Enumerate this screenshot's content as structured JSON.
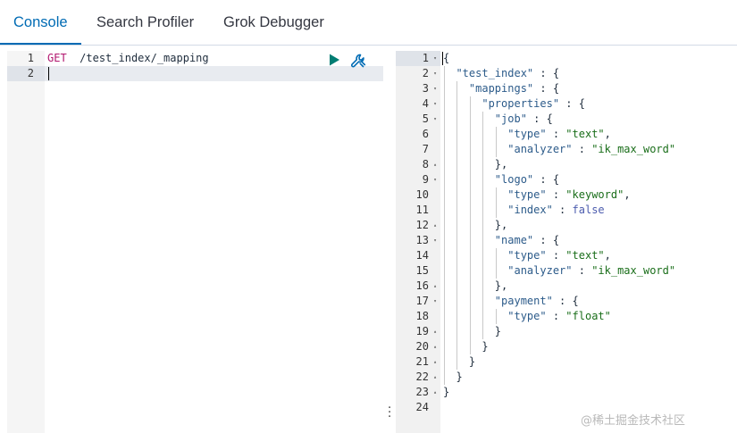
{
  "tabs": [
    {
      "label": "Console"
    },
    {
      "label": "Search Profiler"
    },
    {
      "label": "Grok Debugger"
    }
  ],
  "request": {
    "line_numbers": [
      "1",
      "2"
    ],
    "method": "GET",
    "path": "/test_index/_mapping"
  },
  "response": {
    "line_numbers": [
      "1",
      "2",
      "3",
      "4",
      "5",
      "6",
      "7",
      "8",
      "9",
      "10",
      "11",
      "12",
      "13",
      "14",
      "15",
      "16",
      "17",
      "18",
      "19",
      "20",
      "21",
      "22",
      "23",
      "24"
    ],
    "lines": [
      [
        {
          "t": "{",
          "c": "punc"
        }
      ],
      [
        {
          "t": "  ",
          "c": "punc"
        },
        {
          "t": "\"test_index\"",
          "c": "str-key"
        },
        {
          "t": " : {",
          "c": "punc"
        }
      ],
      [
        {
          "t": "    ",
          "c": "punc"
        },
        {
          "t": "\"mappings\"",
          "c": "str-key"
        },
        {
          "t": " : {",
          "c": "punc"
        }
      ],
      [
        {
          "t": "      ",
          "c": "punc"
        },
        {
          "t": "\"properties\"",
          "c": "str-key"
        },
        {
          "t": " : {",
          "c": "punc"
        }
      ],
      [
        {
          "t": "        ",
          "c": "punc"
        },
        {
          "t": "\"job\"",
          "c": "str-key"
        },
        {
          "t": " : {",
          "c": "punc"
        }
      ],
      [
        {
          "t": "          ",
          "c": "punc"
        },
        {
          "t": "\"type\"",
          "c": "str-key"
        },
        {
          "t": " : ",
          "c": "punc"
        },
        {
          "t": "\"text\"",
          "c": "str-val"
        },
        {
          "t": ",",
          "c": "punc"
        }
      ],
      [
        {
          "t": "          ",
          "c": "punc"
        },
        {
          "t": "\"analyzer\"",
          "c": "str-key"
        },
        {
          "t": " : ",
          "c": "punc"
        },
        {
          "t": "\"ik_max_word\"",
          "c": "str-val"
        }
      ],
      [
        {
          "t": "        },",
          "c": "punc"
        }
      ],
      [
        {
          "t": "        ",
          "c": "punc"
        },
        {
          "t": "\"logo\"",
          "c": "str-key"
        },
        {
          "t": " : {",
          "c": "punc"
        }
      ],
      [
        {
          "t": "          ",
          "c": "punc"
        },
        {
          "t": "\"type\"",
          "c": "str-key"
        },
        {
          "t": " : ",
          "c": "punc"
        },
        {
          "t": "\"keyword\"",
          "c": "str-val"
        },
        {
          "t": ",",
          "c": "punc"
        }
      ],
      [
        {
          "t": "          ",
          "c": "punc"
        },
        {
          "t": "\"index\"",
          "c": "str-key"
        },
        {
          "t": " : ",
          "c": "punc"
        },
        {
          "t": "false",
          "c": "bool"
        }
      ],
      [
        {
          "t": "        },",
          "c": "punc"
        }
      ],
      [
        {
          "t": "        ",
          "c": "punc"
        },
        {
          "t": "\"name\"",
          "c": "str-key"
        },
        {
          "t": " : {",
          "c": "punc"
        }
      ],
      [
        {
          "t": "          ",
          "c": "punc"
        },
        {
          "t": "\"type\"",
          "c": "str-key"
        },
        {
          "t": " : ",
          "c": "punc"
        },
        {
          "t": "\"text\"",
          "c": "str-val"
        },
        {
          "t": ",",
          "c": "punc"
        }
      ],
      [
        {
          "t": "          ",
          "c": "punc"
        },
        {
          "t": "\"analyzer\"",
          "c": "str-key"
        },
        {
          "t": " : ",
          "c": "punc"
        },
        {
          "t": "\"ik_max_word\"",
          "c": "str-val"
        }
      ],
      [
        {
          "t": "        },",
          "c": "punc"
        }
      ],
      [
        {
          "t": "        ",
          "c": "punc"
        },
        {
          "t": "\"payment\"",
          "c": "str-key"
        },
        {
          "t": " : {",
          "c": "punc"
        }
      ],
      [
        {
          "t": "          ",
          "c": "punc"
        },
        {
          "t": "\"type\"",
          "c": "str-key"
        },
        {
          "t": " : ",
          "c": "punc"
        },
        {
          "t": "\"float\"",
          "c": "str-val"
        }
      ],
      [
        {
          "t": "        }",
          "c": "punc"
        }
      ],
      [
        {
          "t": "      }",
          "c": "punc"
        }
      ],
      [
        {
          "t": "    }",
          "c": "punc"
        }
      ],
      [
        {
          "t": "  }",
          "c": "punc"
        }
      ],
      [
        {
          "t": "}",
          "c": "punc"
        }
      ],
      []
    ],
    "fold_markers": [
      "▾",
      "▾",
      "▾",
      "▾",
      "▾",
      "",
      "",
      "▴",
      "▾",
      "",
      "",
      "▴",
      "▾",
      "",
      "",
      "▴",
      "▾",
      "",
      "▴",
      "▴",
      "▴",
      "▴",
      "▴",
      ""
    ]
  },
  "icons": {
    "run": "play-icon",
    "settings": "wrench-icon",
    "resizer": "vertical-dots-icon"
  },
  "watermark": "@稀土掘金技术社区",
  "colors": {
    "accent": "#006bb4",
    "run": "#017d73"
  }
}
